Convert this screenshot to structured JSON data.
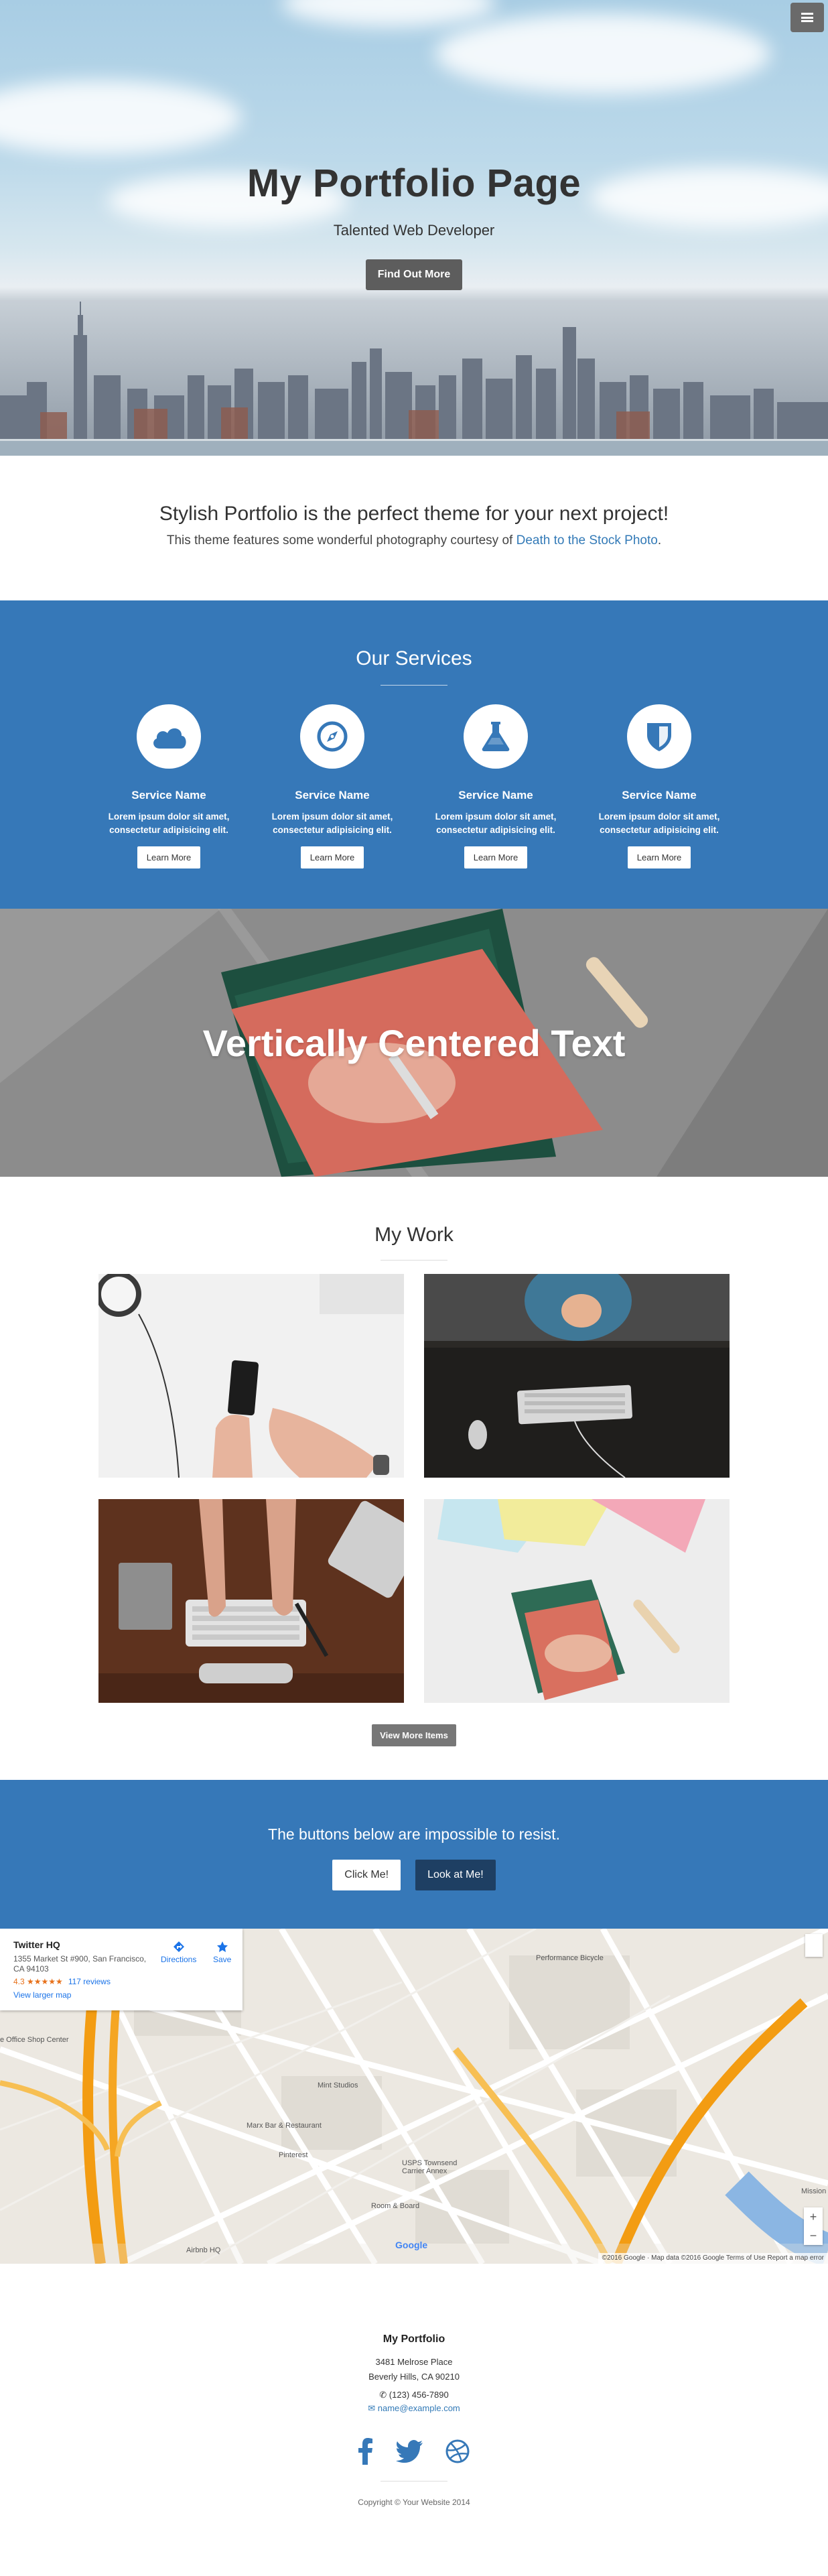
{
  "header": {
    "menu_icon": "hamburger-icon",
    "title": "My Portfolio Page",
    "subtitle": "Talented Web Developer",
    "cta_label": "Find Out More"
  },
  "about": {
    "heading": "Stylish Portfolio is the perfect theme for your next project!",
    "text_before": "This theme features some wonderful photography courtesy of ",
    "link_text": "Death to the Stock Photo",
    "text_after": "."
  },
  "services": {
    "heading": "Our Services",
    "items": [
      {
        "icon": "cloud-icon",
        "name": "Service Name",
        "desc_line1": "Lorem ipsum dolor sit amet,",
        "desc_line2": "consectetur adipisicing elit.",
        "button": "Learn More"
      },
      {
        "icon": "compass-icon",
        "name": "Service Name",
        "desc_line1": "Lorem ipsum dolor sit amet,",
        "desc_line2": "consectetur adipisicing elit.",
        "button": "Learn More"
      },
      {
        "icon": "flask-icon",
        "name": "Service Name",
        "desc_line1": "Lorem ipsum dolor sit amet,",
        "desc_line2": "consectetur adipisicing elit.",
        "button": "Learn More"
      },
      {
        "icon": "shield-icon",
        "name": "Service Name",
        "desc_line1": "Lorem ipsum dolor sit amet,",
        "desc_line2": "consectetur adipisicing elit.",
        "button": "Learn More"
      }
    ],
    "accent": "#3678b8"
  },
  "callout": {
    "text": "Vertically Centered Text"
  },
  "portfolio": {
    "heading": "My Work",
    "more_label": "View More Items"
  },
  "cta": {
    "heading": "The buttons below are impossible to resist.",
    "button1": "Click Me!",
    "button2": "Look at Me!"
  },
  "map": {
    "place_title": "Twitter HQ",
    "place_address": "1355 Market St #900, San Francisco, CA 94103",
    "rating": "4.3 ★★★★★",
    "reviews": "117 reviews",
    "larger_map": "View larger map",
    "directions": "Directions",
    "save": "Save",
    "labels": [
      "Performance Bicycle",
      "Mint Studios",
      "Marx Bar & Restaurant",
      "Pinterest",
      "USPS Townsend Carrier Annex",
      "Room & Board",
      "Airbnb HQ",
      "e Office Shop Center",
      "Mission"
    ],
    "attribution": "©2016 Google · Map data ©2016 Google    Terms of Use    Report a map error",
    "google": "Google",
    "zoom_in": "+",
    "zoom_out": "−"
  },
  "footer": {
    "title": "My Portfolio",
    "address_line1": "3481 Melrose Place",
    "address_line2": "Beverly Hills, CA 90210",
    "phone": "(123) 456-7890",
    "email": "name@example.com",
    "social": [
      "facebook-icon",
      "twitter-icon",
      "dribbble-icon"
    ],
    "copyright": "Copyright © Your Website 2014"
  }
}
